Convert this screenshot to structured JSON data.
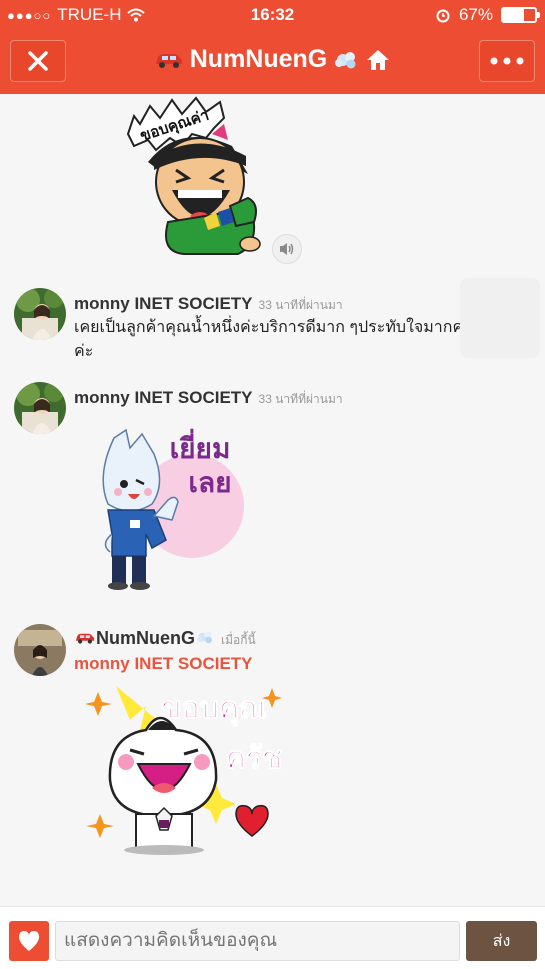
{
  "status": {
    "carrier": "TRUE-H",
    "time": "16:32",
    "battery": "67%",
    "battery_level": 0.67
  },
  "nav": {
    "title": "NumNuenG",
    "title_prefix_icon": "car-emoji",
    "title_suffix_icon": "dash-emoji",
    "home_icon": "home-icon",
    "close_icon": "close-icon",
    "more_icon": "more-icon"
  },
  "comments": [
    {
      "name": "monny INET  SOCIETY",
      "time": "33 นาทีที่ผ่านมา",
      "text": "เคยเป็นลูกค้าคุณน้ำหนึ่งค่ะบริการดีมาก ๆประทับใจมากค่ะ ไม่แพงค่ะ"
    },
    {
      "name": "monny INET  SOCIETY",
      "time": "33 นาทีที่ผ่านมา"
    },
    {
      "name": "NumNuenG",
      "time": "เมื่อกี้นี้",
      "reply_to": "monny INET  SOCIETY"
    }
  ],
  "stickers": {
    "sticker1_text": "ขอบคุณค่า",
    "sticker2_text": "เยี่ยม",
    "sticker2_text_line2": "เลย",
    "sticker3_text": "ขอบคุณ",
    "sticker3_text_line2": "ครัช"
  },
  "input": {
    "placeholder": "แสดงความคิดเห็นของคุณ",
    "send_label": "ส่ง"
  },
  "colors": {
    "brand": "#ec4d33",
    "send": "#6d5342",
    "reply_name": "#e8553e"
  }
}
